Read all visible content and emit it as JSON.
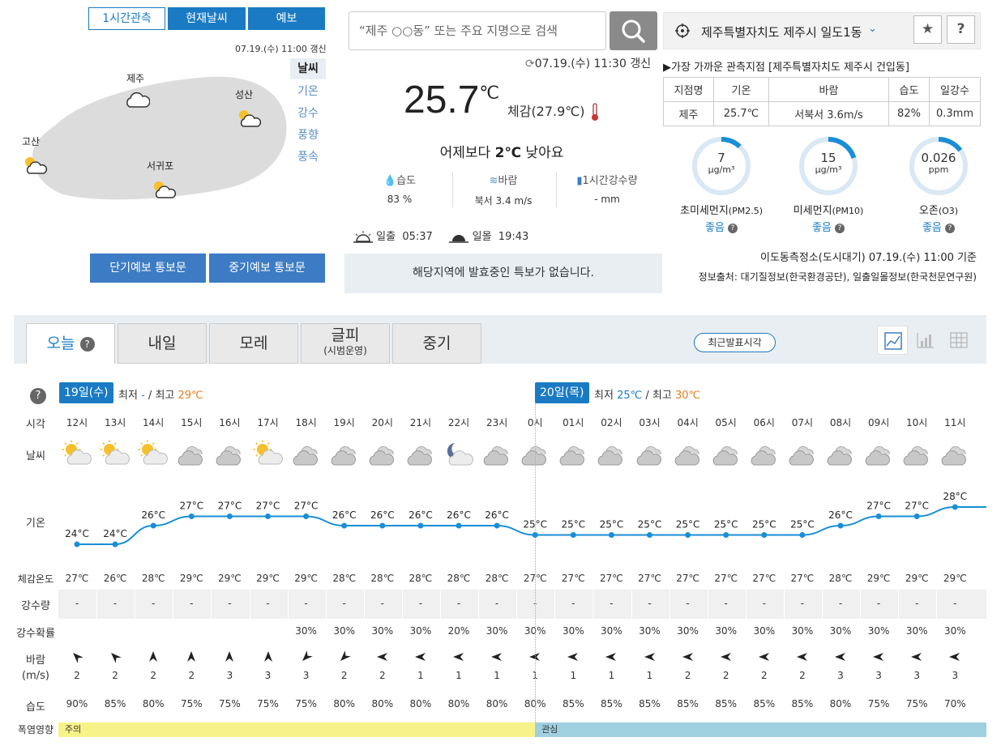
{
  "map": {
    "tabs": [
      "1시간관측",
      "현재날씨",
      "예보"
    ],
    "updated": "07.19.(수) 11:00 갱신",
    "side_items": [
      "날씨",
      "기온",
      "강수",
      "풍향",
      "풍속"
    ],
    "cities": [
      {
        "name": "제주",
        "icon": "cloud-icon"
      },
      {
        "name": "성산",
        "icon": "partly-sunny-icon"
      },
      {
        "name": "고산",
        "icon": "partly-sunny-icon"
      },
      {
        "name": "서귀포",
        "icon": "partly-sunny-icon"
      }
    ],
    "buttons": [
      "단기예보 통보문",
      "중기예보 통보문"
    ]
  },
  "search": {
    "placeholder": "“제주 ○○동” 또는 주요 지명으로 검색"
  },
  "current": {
    "updated": "07.19.(수) 11:30 갱신",
    "temp": "25.7",
    "unit": "℃",
    "feels": "체감(27.9℃)",
    "compare_prefix": "어제보다 ",
    "compare_value": "2℃",
    "compare_suffix": " 낮아요",
    "humidity_label": "습도",
    "humidity_value": "83 %",
    "wind_label": "바람",
    "wind_value": "북서 3.4 m/s",
    "rain_label": "1시간강수량",
    "rain_value": "- mm",
    "sunrise_label": "일출",
    "sunrise": "05:37",
    "sunset_label": "일몰",
    "sunset": "19:43",
    "notice": "해당지역에 발효중인 특보가 없습니다."
  },
  "location": {
    "name": "제주특별자치도 제주시 일도1동",
    "nearest": "▶가장 가까운 관측지점 [제주특별자치도 제주시 건입동]",
    "table_headers": [
      "지점명",
      "기온",
      "바람",
      "습도",
      "일강수"
    ],
    "table_row": [
      "제주",
      "25.7℃",
      "서북서 3.6m/s",
      "82%",
      "0.3mm"
    ]
  },
  "air": {
    "items": [
      {
        "value": "7",
        "unit": "μg/m³",
        "label": "초미세먼지",
        "sub": "(PM2.5)",
        "status": "좋음",
        "level": 0.12
      },
      {
        "value": "15",
        "unit": "μg/m³",
        "label": "미세먼지",
        "sub": "(PM10)",
        "status": "좋음",
        "level": 0.2
      },
      {
        "value": "0.026",
        "unit": "ppm",
        "label": "오존",
        "sub": "(O3)",
        "status": "좋음",
        "level": 0.15
      }
    ],
    "station": "이도동측정소(도시대기) 07.19.(수) 11:00 기준",
    "source": "정보출처: 대기질정보(한국환경공단), 일출일몰정보(한국천문연구원)"
  },
  "forecast": {
    "tabs": [
      "오늘",
      "내일",
      "모레",
      "글피",
      "중기"
    ],
    "tab_sub": "(시범운영)",
    "latest_btn": "최근발표시각",
    "day1": {
      "badge": "19일(수)",
      "min_label": "최저",
      "min": "-",
      "sep": "/",
      "max_label": "최고",
      "max": "29℃"
    },
    "day2": {
      "badge": "20일(목)",
      "min_label": "최저",
      "min": "25℃",
      "sep": "/",
      "max_label": "최고",
      "max": "30℃"
    },
    "row_labels": [
      "시각",
      "날씨",
      "기온",
      "체감온도",
      "강수량",
      "강수확률",
      "바람\n(m/s)",
      "습도",
      "폭염영향"
    ],
    "hours": [
      "12시",
      "13시",
      "14시",
      "15시",
      "16시",
      "17시",
      "18시",
      "19시",
      "20시",
      "21시",
      "22시",
      "23시",
      "0시",
      "01시",
      "02시",
      "03시",
      "04시",
      "05시",
      "06시",
      "07시",
      "08시",
      "09시",
      "10시",
      "11시"
    ],
    "icons": [
      "partly",
      "partly",
      "partly",
      "cloud",
      "cloud",
      "partly",
      "cloud",
      "cloud",
      "cloud",
      "cloud",
      "moon",
      "cloud",
      "cloud",
      "cloud",
      "cloud",
      "cloud",
      "cloud",
      "cloud",
      "cloud",
      "cloud",
      "cloud",
      "cloud",
      "cloud",
      "cloud"
    ],
    "temps": [
      24,
      24,
      26,
      27,
      27,
      27,
      27,
      26,
      26,
      26,
      26,
      26,
      25,
      25,
      25,
      25,
      25,
      25,
      25,
      25,
      26,
      27,
      27,
      28
    ],
    "feels": [
      "27℃",
      "26℃",
      "28℃",
      "29℃",
      "29℃",
      "29℃",
      "29℃",
      "28℃",
      "28℃",
      "28℃",
      "28℃",
      "28℃",
      "27℃",
      "27℃",
      "27℃",
      "27℃",
      "27℃",
      "27℃",
      "27℃",
      "27℃",
      "28℃",
      "29℃",
      "29℃",
      "29℃"
    ],
    "rain": [
      "-",
      "-",
      "-",
      "-",
      "-",
      "-",
      "-",
      "-",
      "-",
      "-",
      "-",
      "-",
      "-",
      "-",
      "-",
      "-",
      "-",
      "-",
      "-",
      "-",
      "-",
      "-",
      "-",
      "-"
    ],
    "pop": [
      "",
      "",
      "",
      "",
      "",
      "",
      "30%",
      "30%",
      "30%",
      "30%",
      "20%",
      "30%",
      "30%",
      "30%",
      "30%",
      "30%",
      "30%",
      "30%",
      "30%",
      "30%",
      "30%",
      "30%",
      "30%",
      "30%"
    ],
    "wind_dir_deg": [
      315,
      315,
      0,
      0,
      0,
      0,
      225,
      225,
      270,
      270,
      270,
      270,
      270,
      270,
      270,
      270,
      270,
      270,
      270,
      270,
      270,
      270,
      270,
      270
    ],
    "wind_speed": [
      "2",
      "2",
      "2",
      "2",
      "3",
      "3",
      "3",
      "2",
      "2",
      "1",
      "1",
      "1",
      "1",
      "1",
      "1",
      "1",
      "2",
      "2",
      "2",
      "2",
      "3",
      "3",
      "3",
      "3"
    ],
    "humidity": [
      "90%",
      "85%",
      "80%",
      "75%",
      "75%",
      "75%",
      "75%",
      "80%",
      "80%",
      "80%",
      "80%",
      "80%",
      "80%",
      "85%",
      "85%",
      "85%",
      "85%",
      "85%",
      "85%",
      "85%",
      "80%",
      "75%",
      "75%",
      "70%"
    ],
    "heat": [
      {
        "label": "주의",
        "color": "#f7f38a",
        "from": 0,
        "to": 13
      },
      {
        "label": "관심",
        "color": "#9fd0e0",
        "from": 13,
        "to": 24
      }
    ]
  }
}
